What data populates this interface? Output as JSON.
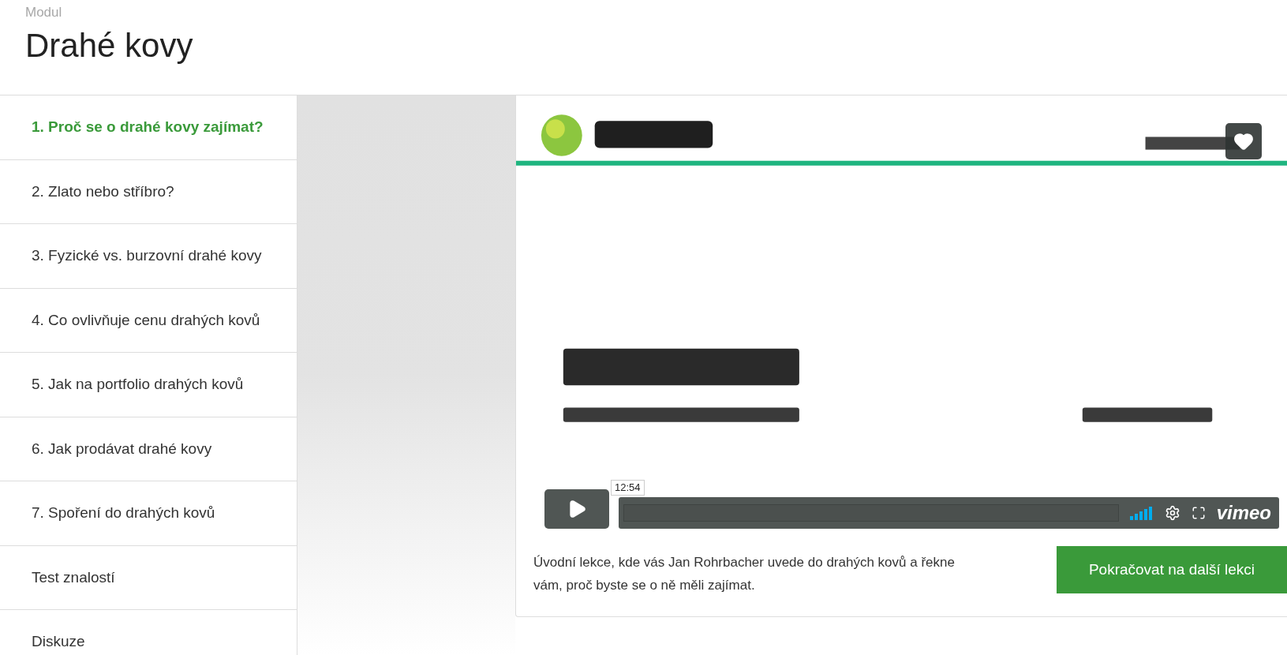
{
  "header": {
    "eyebrow": "Modul",
    "title": "Drahé kovy"
  },
  "sidebar": {
    "items": [
      {
        "label": "1. Proč se o drahé kovy zajímat?",
        "selected": true
      },
      {
        "label": "2. Zlato nebo stříbro?",
        "selected": false
      },
      {
        "label": "3. Fyzické vs. burzovní drahé kovy",
        "selected": false
      },
      {
        "label": "4. Co ovlivňuje cenu drahých kovů",
        "selected": false
      },
      {
        "label": "5. Jak na portfolio drahých kovů",
        "selected": false
      },
      {
        "label": "6. Jak prodávat drahé kovy",
        "selected": false
      },
      {
        "label": "7. Spoření do drahých kovů",
        "selected": false
      },
      {
        "label": "Test znalostí",
        "selected": false
      },
      {
        "label": "Diskuze",
        "selected": false
      }
    ]
  },
  "player": {
    "tooltip": "12:54",
    "brand": "vimeo"
  },
  "lesson": {
    "description": "Úvodní lekce, kde vás Jan Rohrbacher uvede do drahých kovů a řekne vám, proč byste se o ně měli zajímat.",
    "next_button": "Pokračovat na další lekci"
  }
}
